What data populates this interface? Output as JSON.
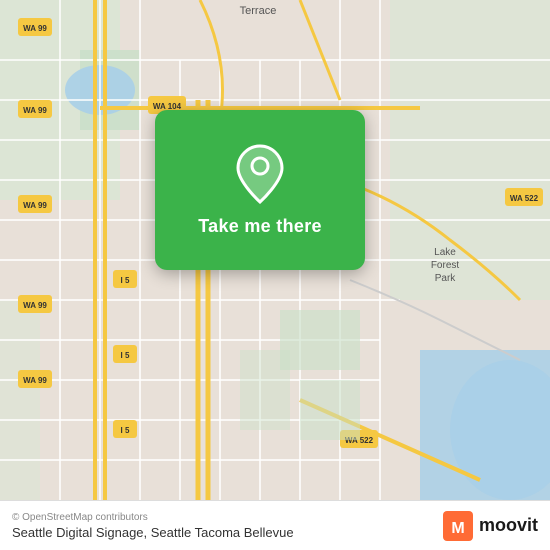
{
  "map": {
    "background_color": "#e8e0d8",
    "attribution": "© OpenStreetMap contributors"
  },
  "card": {
    "button_label": "Take me there",
    "background_color": "#3bb34a"
  },
  "bottom_bar": {
    "copyright": "© OpenStreetMap contributors",
    "location": "Seattle Digital Signage, Seattle Tacoma Bellevue",
    "moovit_label": "moovit"
  },
  "roads": {
    "wa99_label": "WA 99",
    "wa104_label": "WA 104",
    "wa522_label": "WA 522",
    "i5_label": "I 5",
    "lake_forest_park": "Lake\nForest\nPark",
    "terrace": "Terrace"
  }
}
